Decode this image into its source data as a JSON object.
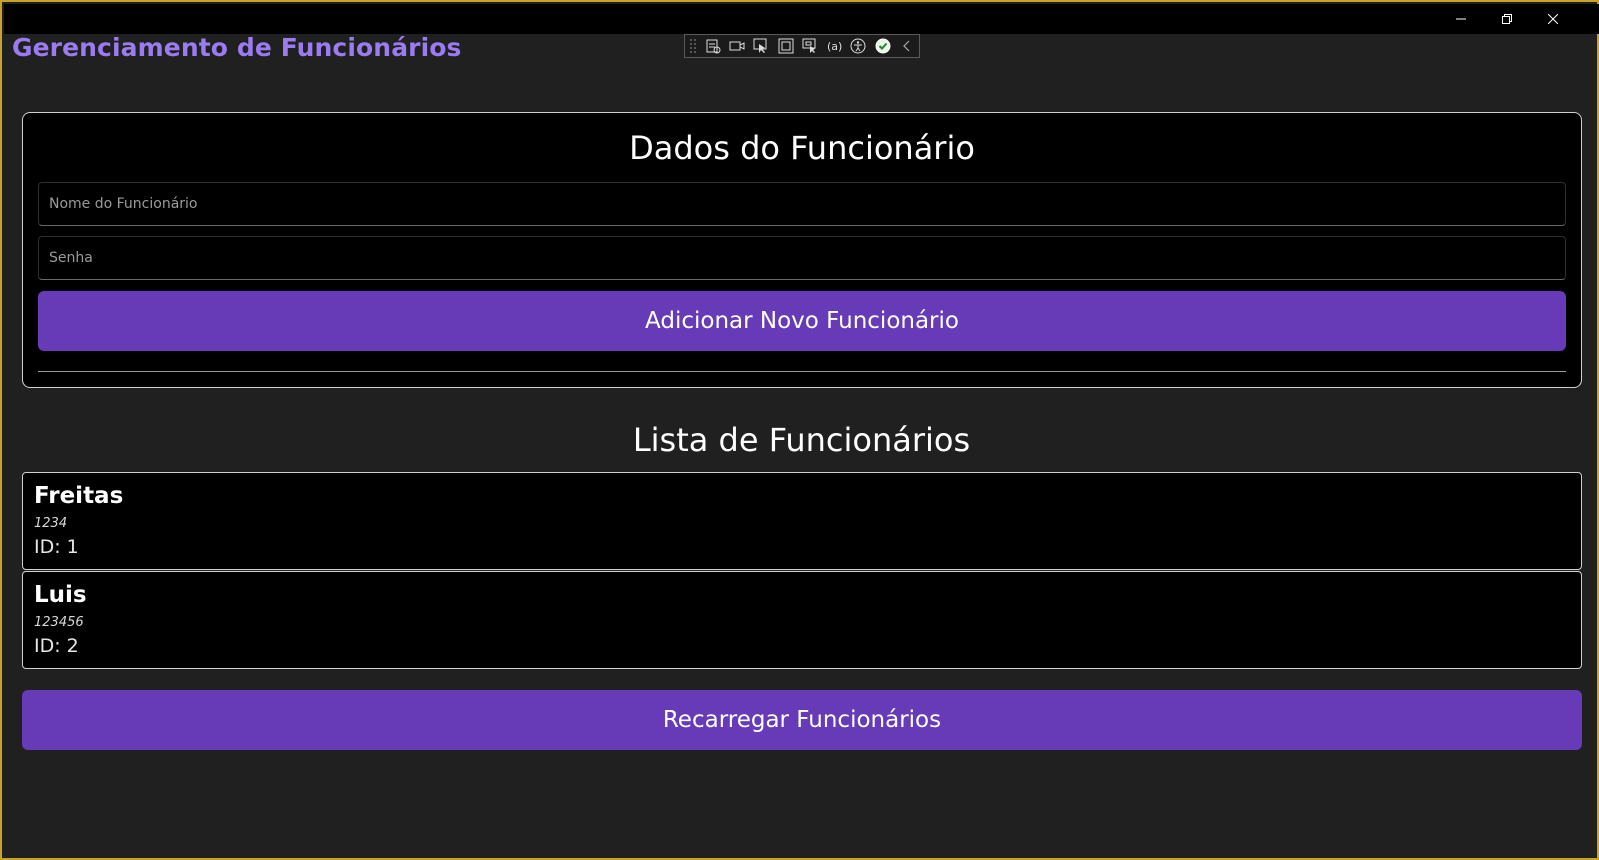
{
  "window": {
    "caption_buttons": [
      {
        "name": "minimize-button",
        "icon": "minimize-icon"
      },
      {
        "name": "restore-button",
        "icon": "restore-icon"
      },
      {
        "name": "close-button",
        "icon": "close-icon"
      }
    ],
    "frame_color": "#c9a227"
  },
  "app": {
    "title": "Gerenciamento de Funcionários",
    "title_color": "#9b7bf0"
  },
  "debug_toolbar": {
    "tools": [
      "go-to-live-visual-tree-icon",
      "display-runtime-tools-icon",
      "select-element-icon",
      "display-layout-adorners-icon",
      "track-focused-element-icon",
      "binding-failures-icon",
      "accessibility-scan-icon",
      "checkmark-icon",
      "collapse-toolbar-icon"
    ]
  },
  "form": {
    "title": "Dados do Funcionário",
    "name_placeholder": "Nome do Funcionário",
    "password_placeholder": "Senha",
    "add_button_label": "Adicionar Novo Funcionário"
  },
  "list": {
    "title": "Lista de Funcionários",
    "employees": [
      {
        "name": "Freitas",
        "password": "1234",
        "id_label": "ID: 1"
      },
      {
        "name": "Luis",
        "password": "123456",
        "id_label": "ID: 2"
      }
    ]
  },
  "reload_button_label": "Recarregar Funcionários",
  "colors": {
    "accent": "#673ab7",
    "background": "#202020",
    "card": "#000000"
  }
}
